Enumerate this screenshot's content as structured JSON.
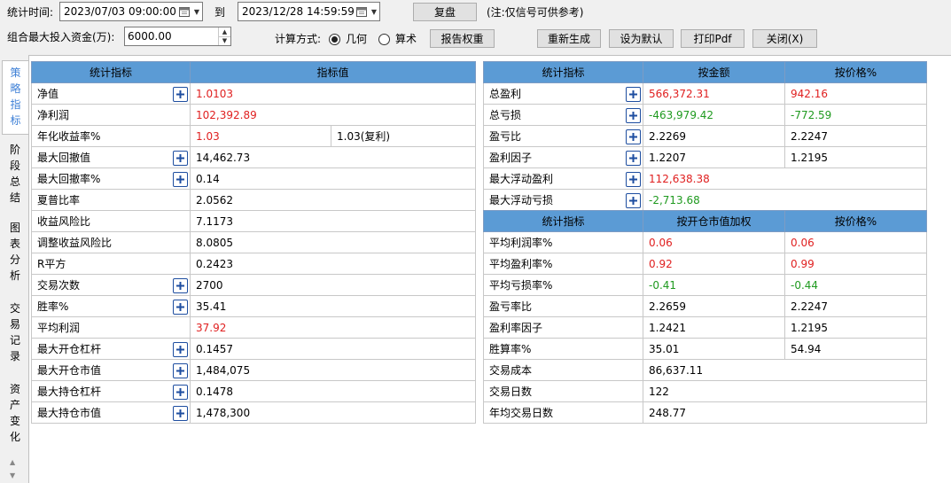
{
  "toolbar": {
    "stat_time_label": "统计时间:",
    "start_time": "2023/07/03 09:00:00",
    "to_label": "到",
    "end_time": "2023/12/28 14:59:59",
    "replay_button": "复盘",
    "note": "(注:仅信号可供参考)",
    "max_capital_label": "组合最大投入资金(万):",
    "max_capital_value": "6000.00",
    "calc_method_label": "计算方式:",
    "geometric_label": "几何",
    "arithmetic_label": "算术",
    "calc_method_selected": "几何",
    "report_weight_button": "报告权重",
    "regenerate_button": "重新生成",
    "set_default_button": "设为默认",
    "print_pdf_button": "打印Pdf",
    "close_button": "关闭(X)"
  },
  "side_tabs": [
    {
      "label": "策略指标",
      "chars": [
        "策",
        "略",
        "指",
        "标"
      ],
      "active": true
    },
    {
      "label": "阶段总结",
      "chars": [
        "阶",
        "段",
        "总",
        "结"
      ],
      "active": false
    },
    {
      "label": "图表分析",
      "chars": [
        "图",
        "表",
        "分",
        "析"
      ],
      "active": false
    },
    {
      "label": "交易记录",
      "chars": [
        "交",
        "易",
        "记",
        "录"
      ],
      "active": false
    },
    {
      "label": "资产变化",
      "chars": [
        "资",
        "产",
        "变",
        "化"
      ],
      "active": false
    }
  ],
  "left_table": {
    "headers": [
      "统计指标",
      "指标值"
    ],
    "rows": [
      {
        "name": "净值",
        "expand": true,
        "value": "1.0103",
        "color": "red"
      },
      {
        "name": "净利润",
        "expand": false,
        "value": "102,392.89",
        "color": "red"
      },
      {
        "name": "年化收益率%",
        "expand": false,
        "value": "1.03",
        "color": "red",
        "extra": "1.03(复利)"
      },
      {
        "name": "最大回撤值",
        "expand": true,
        "value": "14,462.73",
        "color": ""
      },
      {
        "name": "最大回撤率%",
        "expand": true,
        "value": "0.14",
        "color": ""
      },
      {
        "name": "夏普比率",
        "expand": false,
        "value": "2.0562",
        "color": ""
      },
      {
        "name": "收益风险比",
        "expand": false,
        "value": "7.1173",
        "color": ""
      },
      {
        "name": "调整收益风险比",
        "expand": false,
        "value": "8.0805",
        "color": ""
      },
      {
        "name": "R平方",
        "expand": false,
        "value": "0.2423",
        "color": ""
      },
      {
        "name": "交易次数",
        "expand": true,
        "value": "2700",
        "color": ""
      },
      {
        "name": "胜率%",
        "expand": true,
        "value": "35.41",
        "color": ""
      },
      {
        "name": "平均利润",
        "expand": false,
        "value": "37.92",
        "color": "red"
      },
      {
        "name": "最大开仓杠杆",
        "expand": true,
        "value": "0.1457",
        "color": ""
      },
      {
        "name": "最大开仓市值",
        "expand": true,
        "value": "1,484,075",
        "color": ""
      },
      {
        "name": "最大持仓杠杆",
        "expand": true,
        "value": "0.1478",
        "color": ""
      },
      {
        "name": "最大持仓市值",
        "expand": true,
        "value": "1,478,300",
        "color": ""
      }
    ]
  },
  "right_table_top": {
    "headers": [
      "统计指标",
      "按金额",
      "按价格%"
    ],
    "rows": [
      {
        "name": "总盈利",
        "expand": true,
        "amount": "566,372.31",
        "amount_color": "red",
        "pct": "942.16",
        "pct_color": "red"
      },
      {
        "name": "总亏损",
        "expand": true,
        "amount": "-463,979.42",
        "amount_color": "green",
        "pct": "-772.59",
        "pct_color": "green"
      },
      {
        "name": "盈亏比",
        "expand": true,
        "amount": "2.2269",
        "amount_color": "",
        "pct": "2.2247",
        "pct_color": ""
      },
      {
        "name": "盈利因子",
        "expand": true,
        "amount": "1.2207",
        "amount_color": "",
        "pct": "1.2195",
        "pct_color": ""
      },
      {
        "name": "最大浮动盈利",
        "expand": true,
        "amount": "112,638.38",
        "amount_color": "red",
        "pct": "",
        "pct_color": ""
      },
      {
        "name": "最大浮动亏损",
        "expand": true,
        "amount": "-2,713.68",
        "amount_color": "green",
        "pct": "",
        "pct_color": ""
      }
    ]
  },
  "right_table_bottom": {
    "headers": [
      "统计指标",
      "按开仓市值加权",
      "按价格%"
    ],
    "rows": [
      {
        "name": "平均利润率%",
        "weighted": "0.06",
        "weighted_color": "red",
        "pct": "0.06",
        "pct_color": "red"
      },
      {
        "name": "平均盈利率%",
        "weighted": "0.92",
        "weighted_color": "red",
        "pct": "0.99",
        "pct_color": "red"
      },
      {
        "name": "平均亏损率%",
        "weighted": "-0.41",
        "weighted_color": "green",
        "pct": "-0.44",
        "pct_color": "green"
      },
      {
        "name": "盈亏率比",
        "weighted": "2.2659",
        "weighted_color": "",
        "pct": "2.2247",
        "pct_color": ""
      },
      {
        "name": "盈利率因子",
        "weighted": "1.2421",
        "weighted_color": "",
        "pct": "1.2195",
        "pct_color": ""
      },
      {
        "name": "胜算率%",
        "weighted": "35.01",
        "weighted_color": "",
        "pct": "54.94",
        "pct_color": ""
      },
      {
        "name": "交易成本",
        "weighted": "86,637.11",
        "weighted_color": "",
        "pct": "",
        "pct_color": "",
        "merged": true
      },
      {
        "name": "交易日数",
        "weighted": "122",
        "weighted_color": "",
        "pct": "",
        "pct_color": "",
        "merged": true
      },
      {
        "name": "年均交易日数",
        "weighted": "248.77",
        "weighted_color": "",
        "pct": "",
        "pct_color": "",
        "merged": true
      }
    ]
  },
  "colors": {
    "header_bg": "#5b9bd5",
    "red": "#e02020",
    "green": "#1f9a1f",
    "active_tab": "#3d7fd6"
  }
}
